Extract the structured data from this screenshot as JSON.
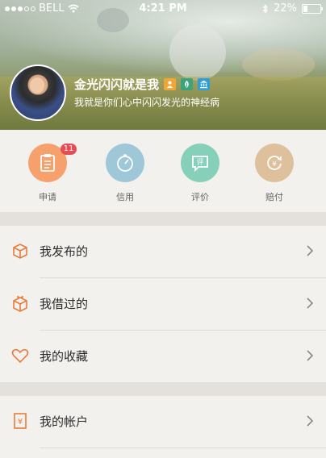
{
  "status_bar": {
    "carrier": "BELL",
    "time": "4:21 PM",
    "battery": "22%"
  },
  "profile": {
    "name": "金光闪闪就是我",
    "motto": "我就是你们心中闪闪发光的神经病",
    "badges": [
      "person-badge-icon",
      "leaf-badge-icon",
      "bank-badge-icon"
    ],
    "badge_colors": [
      "#f0a637",
      "#3aa47c",
      "#2f9fd8"
    ]
  },
  "quick_actions": [
    {
      "label": "申请",
      "icon": "clipboard-icon",
      "color": "#f6a16b",
      "badge": "11"
    },
    {
      "label": "信用",
      "icon": "gauge-icon",
      "color": "#9ec8d8"
    },
    {
      "label": "评价",
      "icon": "comment-icon",
      "color": "#86d0ba"
    },
    {
      "label": "赔付",
      "icon": "refund-icon",
      "color": "#dfc09c"
    }
  ],
  "menu": [
    {
      "label": "我发布的",
      "icon": "box-icon"
    },
    {
      "label": "我借过的",
      "icon": "gift-box-icon"
    },
    {
      "label": "我的收藏",
      "icon": "heart-icon"
    },
    {
      "label": "我的帐户",
      "icon": "yuan-ledger-icon"
    }
  ],
  "accent_color": "#e87c3e"
}
